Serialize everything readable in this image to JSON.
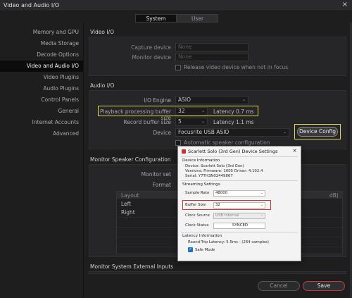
{
  "window": {
    "title": "Video and Audio I/O",
    "close_glyph": "×"
  },
  "tabs": [
    {
      "label": "System"
    },
    {
      "label": "User"
    }
  ],
  "sidebar": {
    "items": [
      {
        "label": "Memory and GPU"
      },
      {
        "label": "Media Storage"
      },
      {
        "label": "Decode Options"
      },
      {
        "label": "Video and Audio I/O"
      },
      {
        "label": "Video Plugins"
      },
      {
        "label": "Audio Plugins"
      },
      {
        "label": "Control Panels"
      },
      {
        "label": "General"
      },
      {
        "label": "Internet Accounts"
      },
      {
        "label": "Advanced"
      }
    ]
  },
  "video_io": {
    "title": "Video I/O",
    "capture_label": "Capture device",
    "capture_value": "None",
    "monitor_label": "Monitor device",
    "monitor_value": "None",
    "release_label": "Release video device when not in focus"
  },
  "audio_io": {
    "title": "Audio I/O",
    "engine_label": "I/O Engine",
    "engine_value": "ASIO",
    "playback_label": "Playback processing buffer size",
    "playback_value": "32",
    "playback_latency_label": "Latency",
    "playback_latency_value": "0.7 ms",
    "record_label": "Record buffer size",
    "record_value": "5",
    "record_latency_label": "Latency",
    "record_latency_value": "1.1 ms",
    "device_label": "Device",
    "device_value": "Focusrite USB ASIO",
    "device_config_label": "Device Config",
    "auto_speaker_label": "Automatic speaker configuration"
  },
  "monitor_speaker": {
    "title": "Monitor Speaker Configuration",
    "monitor_set_label": "Monitor set",
    "format_label": "Format",
    "table_header": "Layout",
    "table_header_right": "dB)",
    "rows": [
      "Left",
      "Right"
    ]
  },
  "monitor_external": {
    "title": "Monitor System External Inputs"
  },
  "footer": {
    "cancel_label": "Cancel",
    "save_label": "Save"
  },
  "dialog": {
    "title": "Scarlett Solo (3rd Gen) Device Settings",
    "close_glyph": "×",
    "device_info_title": "Device Information",
    "device_line": "Device: Scarlett Solo (3rd Gen)",
    "versions_line": "Versions: Firmware: 1605  Driver: 4.102.4",
    "serial_line": "Serial: Y7TH3N02449867",
    "streaming_title": "Streaming Settings",
    "sample_rate_label": "Sample Rate",
    "sample_rate_value": "48000",
    "buffer_size_label": "Buffer Size",
    "buffer_size_value": "32",
    "clock_source_label": "Clock Source",
    "clock_source_value": "USB Internal",
    "clock_status_label": "Clock Status",
    "clock_status_value": "SYNCED",
    "latency_title": "Latency Information",
    "roundtrip_line": "Round-Trip Latency:   5.5ms - (264 samples)",
    "safe_mode_label": "Safe Mode"
  },
  "colors": {
    "highlight_yellow": "#e3d84a",
    "highlight_red": "#d8322e",
    "save_border": "#c73a3f"
  }
}
